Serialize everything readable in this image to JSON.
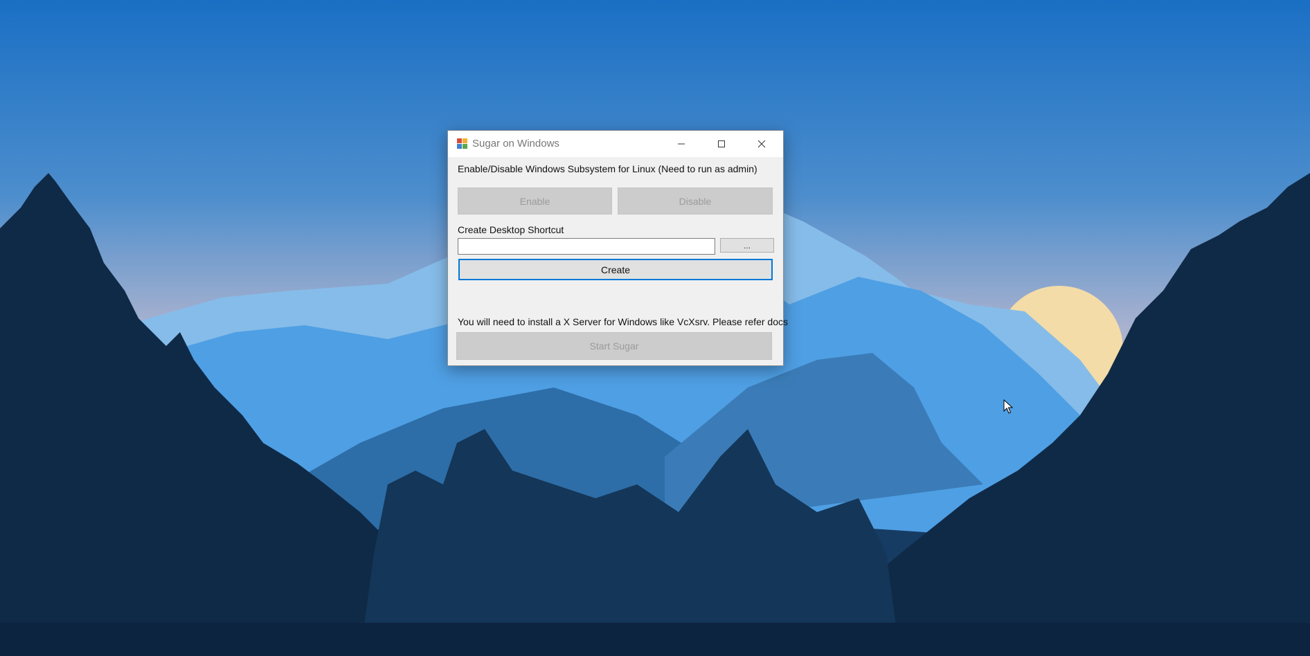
{
  "window": {
    "title": "Sugar on Windows",
    "wsl_label": "Enable/Disable Windows Subsystem for Linux (Need to run as admin)",
    "enable_label": "Enable",
    "disable_label": "Disable",
    "shortcut_label": "Create Desktop Shortcut",
    "shortcut_path_value": "",
    "browse_label": "...",
    "create_label": "Create",
    "xserver_note": "You will need to install a X Server for Windows like VcXsrv. Please refer docs",
    "start_label": "Start Sugar"
  },
  "icons": {
    "app": "sugar-app-icon",
    "minimize": "minimize-icon",
    "maximize": "maximize-icon",
    "close": "close-icon",
    "cursor": "mouse-pointer-icon"
  },
  "colors": {
    "sky_top": "#1a6fc4",
    "sky_horizon": "#b9b7c9",
    "sun": "#f3dca8",
    "dark_trees": "#0f2a47",
    "dialog_bg": "#f0f0f0",
    "focus_border": "#0078d7",
    "disabled_button": "#cccccc"
  }
}
